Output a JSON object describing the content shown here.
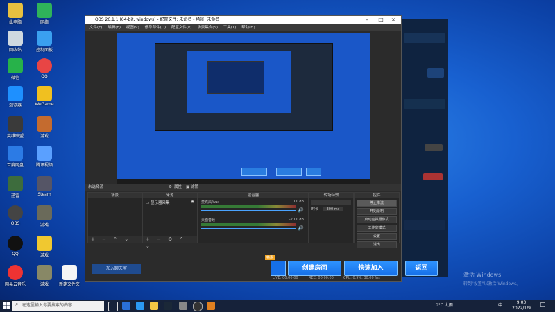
{
  "obs": {
    "title": "OBS 26.1.1 (64-bit, windows) - 配置文件: 未命名 - 场景: 未命名",
    "menu": [
      "文件(F)",
      "编辑(E)",
      "视图(V)",
      "停靠部件(D)",
      "配置文件(P)",
      "场景集合(S)",
      "工具(T)",
      "帮助(H)"
    ],
    "scene_bar_label": "未选择源",
    "properties_label": "属性",
    "filters_label": "滤镜",
    "docks": {
      "scenes": "场景",
      "sources": "来源",
      "mixer": "混音器",
      "transitions": "转场特效",
      "controls": "控件"
    },
    "source_item": "显示器采集",
    "mixer": {
      "ch1_name": "麦克风/Aux",
      "ch1_db": "0.0 dB",
      "ch2_name": "桌面音频",
      "ch2_db": "-20.0 dB"
    },
    "transition": {
      "duration_label": "时长",
      "duration_value": "300 ms"
    },
    "controls": [
      "停止推流",
      "开始录制",
      "启动虚拟摄像机",
      "工作室模式",
      "设置",
      "退出"
    ],
    "status": {
      "live": "LIVE: 00:00:00",
      "rec": "REC: 00:00:00",
      "cpu": "CPU: 0.9%, 30.00 fps"
    }
  },
  "launcher": {
    "big_buttons": [
      "创建房间",
      "快速加入",
      "返回"
    ],
    "join_label": "加入聊天室",
    "tag": "特惠"
  },
  "watermark": {
    "line1": "激活 Windows",
    "line2": "转到\"设置\"以激活 Windows。"
  },
  "taskbar": {
    "search_placeholder": "在这里输入你要搜索的内容",
    "weather": "0°C 大雨",
    "time": "9:03",
    "date": "2022/1/9",
    "ime": "中"
  },
  "desktop": {
    "icons": [
      "此电脑",
      "网络",
      "回收站",
      "控制面板",
      "微信",
      "QQ",
      "浏览器",
      "WeGame",
      "英雄联盟",
      "游戏",
      "百度网盘",
      "腾讯视频",
      "迅雷",
      "Steam",
      "OBS",
      "网易云音乐",
      "新建文件夹"
    ]
  },
  "colors": {
    "obs_bg": "#2b2b2b",
    "accent_blue": "#1670e8",
    "desktop_blue": "#1860d0"
  }
}
